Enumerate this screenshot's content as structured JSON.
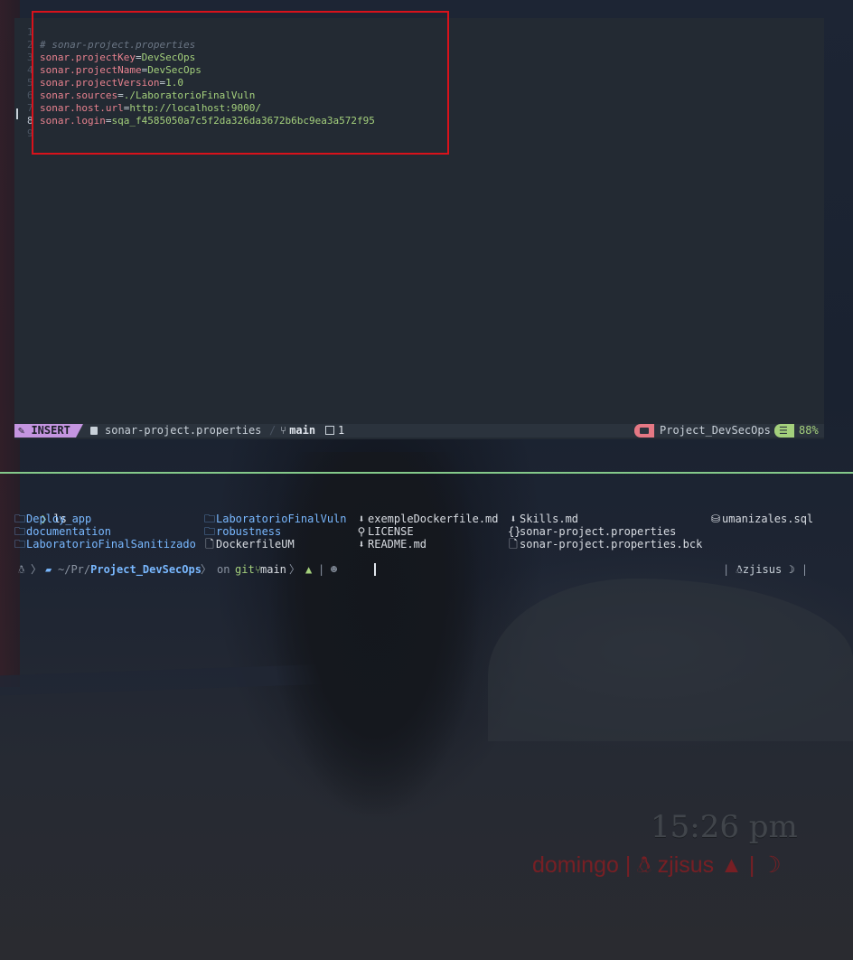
{
  "editor": {
    "lines": [
      {
        "num": "1",
        "tokens": []
      },
      {
        "num": "2",
        "tokens": [
          {
            "t": "comment",
            "v": "# sonar-project.properties"
          }
        ]
      },
      {
        "num": "3",
        "tokens": [
          {
            "t": "key",
            "v": "sonar.projectKey"
          },
          {
            "t": "eq",
            "v": "="
          },
          {
            "t": "val",
            "v": "DevSecOps"
          }
        ]
      },
      {
        "num": "4",
        "tokens": [
          {
            "t": "key",
            "v": "sonar.projectName"
          },
          {
            "t": "eq",
            "v": "="
          },
          {
            "t": "val",
            "v": "DevSecOps"
          }
        ]
      },
      {
        "num": "5",
        "tokens": [
          {
            "t": "key",
            "v": "sonar.projectVersion"
          },
          {
            "t": "eq",
            "v": "="
          },
          {
            "t": "val",
            "v": "1.0"
          }
        ]
      },
      {
        "num": "6",
        "tokens": [
          {
            "t": "key",
            "v": "sonar.sources"
          },
          {
            "t": "eq",
            "v": "="
          },
          {
            "t": "val",
            "v": "./LaboratorioFinalVuln"
          }
        ]
      },
      {
        "num": "7",
        "tokens": [
          {
            "t": "key",
            "v": "sonar.host.url"
          },
          {
            "t": "eq",
            "v": "="
          },
          {
            "t": "val",
            "v": "http://localhost:9000/"
          }
        ]
      },
      {
        "num": "8",
        "tokens": [
          {
            "t": "key",
            "v": "sonar.login"
          },
          {
            "t": "eq",
            "v": "="
          },
          {
            "t": "val",
            "v": "sqa_f4585050a7c5f2da326da3672b6bc9ea3a572f95"
          }
        ],
        "current": true
      },
      {
        "num": "9",
        "tokens": []
      }
    ]
  },
  "statusline": {
    "mode": "INSERT",
    "file": "sonar-project.properties",
    "branch": "main",
    "buffer_count": "1",
    "project": "Project_DevSecOps",
    "percent": "88%"
  },
  "terminal": {
    "prompt_symbol": "❯",
    "command": "ls",
    "ls_items": [
      {
        "name": "Deploy_app",
        "kind": "dir",
        "icon": "folder-icon"
      },
      {
        "name": "documentation",
        "kind": "dir",
        "icon": "folder-icon"
      },
      {
        "name": "LaboratorioFinalSanitizado",
        "kind": "dir",
        "icon": "folder-icon"
      },
      {
        "name": "LaboratorioFinalVuln",
        "kind": "dir",
        "icon": "folder-icon"
      },
      {
        "name": "robustness",
        "kind": "dir",
        "icon": "folder-icon"
      },
      {
        "name": "DockerfileUM",
        "kind": "file",
        "icon": "file-icon"
      },
      {
        "name": "exempleDockerfile.md",
        "kind": "file",
        "icon": "markdown-icon"
      },
      {
        "name": "LICENSE",
        "kind": "file",
        "icon": "license-icon"
      },
      {
        "name": "README.md",
        "kind": "file",
        "icon": "markdown-icon"
      },
      {
        "name": "Skills.md",
        "kind": "file",
        "icon": "markdown-icon"
      },
      {
        "name": "sonar-project.properties",
        "kind": "file",
        "icon": "json-icon"
      },
      {
        "name": "sonar-project.properties.bck",
        "kind": "file",
        "icon": "file-icon"
      },
      {
        "name": "umanizales.sql",
        "kind": "file",
        "icon": "database-icon"
      }
    ],
    "prompt": {
      "path_prefix": "~/Pr/",
      "path_dir": "Project_DevSecOps",
      "on_text": "on",
      "git_label": "git",
      "branch": "main",
      "pipe": "|"
    },
    "right_prompt": {
      "user": "zjisus"
    }
  },
  "desktop": {
    "clock": "15:26 pm",
    "day": "domingo",
    "user": "zjisus"
  }
}
